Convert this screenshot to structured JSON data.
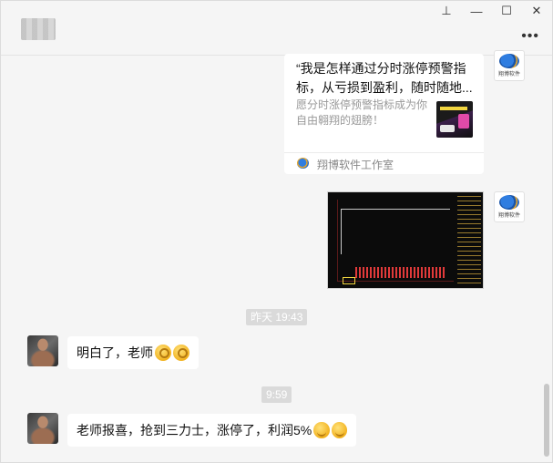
{
  "window": {
    "controls": {
      "pin": "⊥",
      "minimize": "—",
      "maximize": "☐",
      "close": "✕"
    },
    "more": "•••"
  },
  "messages": {
    "card": {
      "title": "“我是怎样通过分时涨停预警指标，从亏损到盈利，随时随地...",
      "description": "愿分时涨停预警指标成为你自由翱翔的翅膀！",
      "source": "翔博软件工作室",
      "brand_avatar_text": "翔博软件"
    },
    "image_brand_avatar_text": "翔博软件",
    "timestamp1": "昨天 19:43",
    "reply1": "明白了，老师",
    "timestamp2": "9:59",
    "reply2": "老师报喜，抢到三力士，涨停了，利润5%"
  }
}
